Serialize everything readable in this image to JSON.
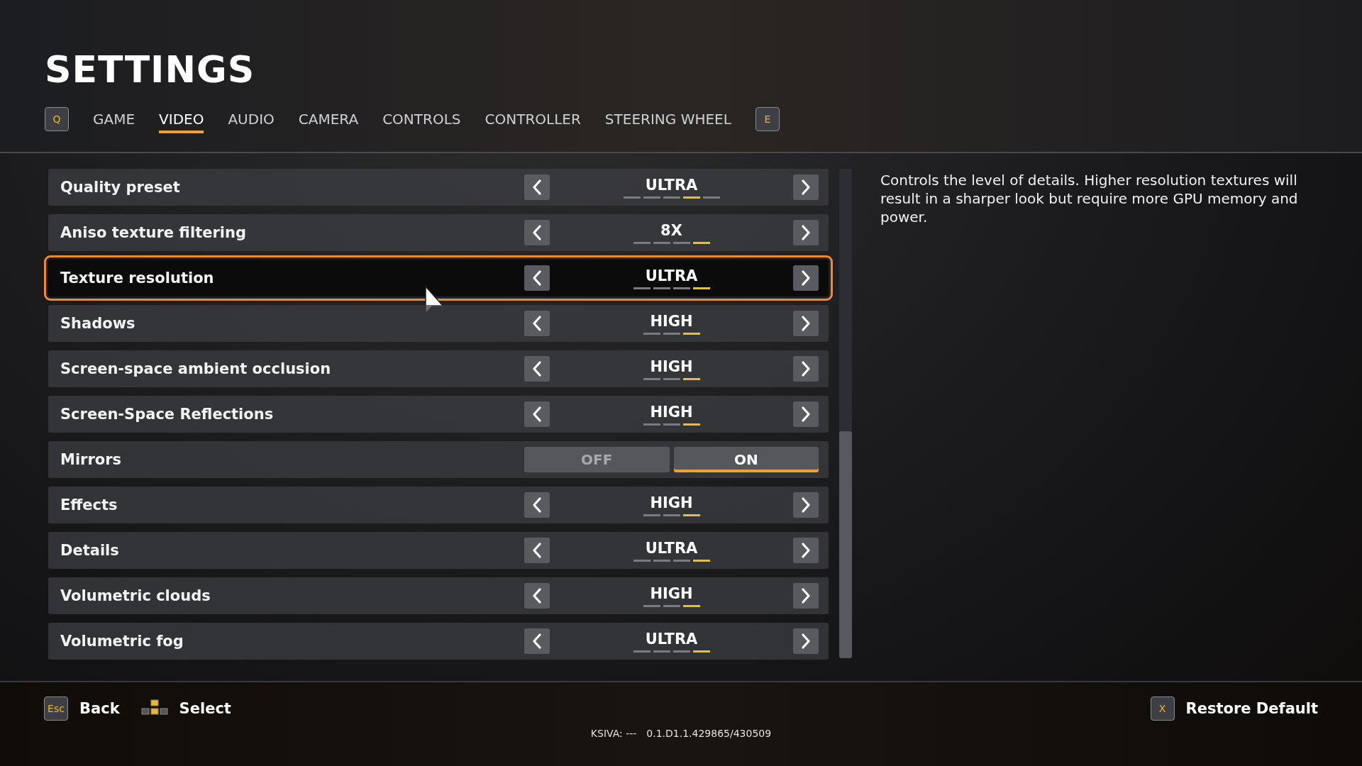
{
  "title": "SETTINGS",
  "tabs": {
    "prev_key": "Q",
    "next_key": "E",
    "items": [
      {
        "label": "GAME",
        "selected": false
      },
      {
        "label": "VIDEO",
        "selected": true
      },
      {
        "label": "AUDIO",
        "selected": false
      },
      {
        "label": "CAMERA",
        "selected": false
      },
      {
        "label": "CONTROLS",
        "selected": false
      },
      {
        "label": "CONTROLLER",
        "selected": false
      },
      {
        "label": "STEERING WHEEL",
        "selected": false
      }
    ]
  },
  "settings": [
    {
      "kind": "stepper",
      "label": "Quality preset",
      "value": "ULTRA",
      "focused": false,
      "segments": [
        {
          "selected": false
        },
        {
          "selected": false
        },
        {
          "selected": false
        },
        {
          "selected": true
        },
        {
          "selected": false
        }
      ]
    },
    {
      "kind": "stepper",
      "label": "Aniso texture filtering",
      "value": "8X",
      "focused": false,
      "segments": [
        {
          "selected": false
        },
        {
          "selected": false
        },
        {
          "selected": false
        },
        {
          "selected": true
        }
      ]
    },
    {
      "kind": "stepper",
      "label": "Texture resolution",
      "value": "ULTRA",
      "focused": true,
      "segments": [
        {
          "selected": false
        },
        {
          "selected": false
        },
        {
          "selected": false
        },
        {
          "selected": true
        }
      ]
    },
    {
      "kind": "stepper",
      "label": "Shadows",
      "value": "HIGH",
      "focused": false,
      "segments": [
        {
          "selected": false
        },
        {
          "selected": false
        },
        {
          "selected": true
        }
      ]
    },
    {
      "kind": "stepper",
      "label": "Screen-space ambient occlusion",
      "value": "HIGH",
      "focused": false,
      "segments": [
        {
          "selected": false
        },
        {
          "selected": false
        },
        {
          "selected": true
        }
      ]
    },
    {
      "kind": "stepper",
      "label": "Screen-Space Reflections",
      "value": "HIGH",
      "focused": false,
      "segments": [
        {
          "selected": false
        },
        {
          "selected": false
        },
        {
          "selected": true
        }
      ]
    },
    {
      "kind": "toggle",
      "label": "Mirrors",
      "focused": false,
      "options": [
        {
          "label": "OFF",
          "selected": false
        },
        {
          "label": "ON",
          "selected": true
        }
      ]
    },
    {
      "kind": "stepper",
      "label": "Effects",
      "value": "HIGH",
      "focused": false,
      "segments": [
        {
          "selected": false
        },
        {
          "selected": false
        },
        {
          "selected": true
        }
      ]
    },
    {
      "kind": "stepper",
      "label": "Details",
      "value": "ULTRA",
      "focused": false,
      "segments": [
        {
          "selected": false
        },
        {
          "selected": false
        },
        {
          "selected": false
        },
        {
          "selected": true
        }
      ]
    },
    {
      "kind": "stepper",
      "label": "Volumetric clouds",
      "value": "HIGH",
      "focused": false,
      "segments": [
        {
          "selected": false
        },
        {
          "selected": false
        },
        {
          "selected": true
        }
      ]
    },
    {
      "kind": "stepper",
      "label": "Volumetric fog",
      "value": "ULTRA",
      "focused": false,
      "segments": [
        {
          "selected": false
        },
        {
          "selected": false
        },
        {
          "selected": false
        },
        {
          "selected": true
        }
      ]
    }
  ],
  "description": "Controls the level of details. Higher resolution textures will result in a sharper look but require more GPU memory and power.",
  "footer": {
    "back_key": "Esc",
    "back": "Back",
    "select": "Select",
    "restore_key": "X",
    "restore": "Restore Default",
    "version_label": "KSIVA: ---",
    "version": "0.1.D1.1.429865/430509"
  }
}
